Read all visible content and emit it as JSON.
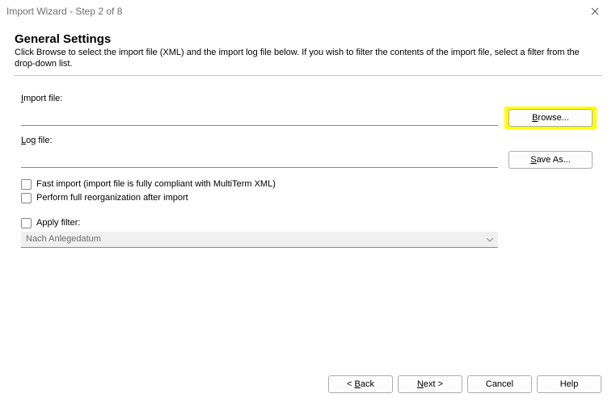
{
  "window": {
    "title": "Import Wizard - Step 2 of 8"
  },
  "heading": "General Settings",
  "subheading": "Click Browse to select the import file (XML) and the import log file below. If you wish to filter the contents of the import file, select a filter from the drop-down list.",
  "form": {
    "importFileLabelPrefix": "I",
    "importFileLabelRest": "mport file:",
    "importFileValue": "",
    "browseLabelPrefix": "B",
    "browseLabelRest": "rowse...",
    "logFileLabelPrefix": "L",
    "logFileLabelRest": "og file:",
    "logFileValue": "",
    "saveAsLabelPrefix": "S",
    "saveAsLabelRest": "ave As...",
    "fastImportPrefix": "F",
    "fastImportRest": "ast import (import file is fully compliant with MultiTerm XML)",
    "reorgPrefix": "P",
    "reorgRest": "erform full reorganization after import",
    "applyFilterPrefix": "A",
    "applyFilterRest": "pply filter:",
    "filterSelected": "Nach Anlegedatum"
  },
  "footer": {
    "backPrefix": "< ",
    "backUl": "B",
    "backRest": "ack",
    "nextUl": "N",
    "nextRest": "ext >",
    "cancel": "Cancel",
    "help": "Help"
  }
}
